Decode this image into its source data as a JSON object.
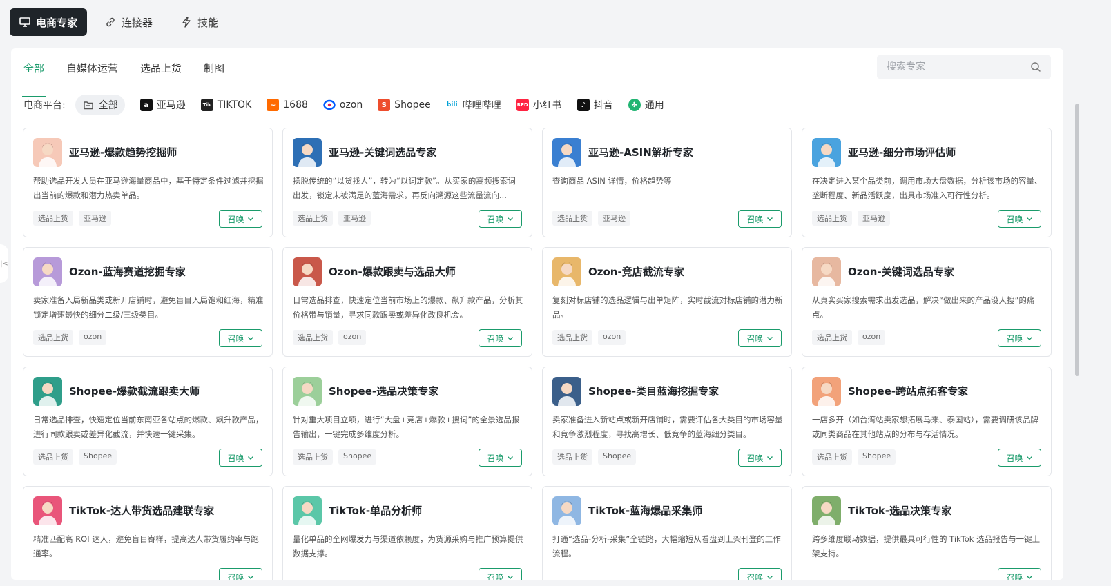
{
  "top_tabs": [
    {
      "label": "电商专家",
      "icon": "monitor-icon",
      "active": true
    },
    {
      "label": "连接器",
      "icon": "link-icon",
      "active": false
    },
    {
      "label": "技能",
      "icon": "lightning-icon",
      "active": false
    }
  ],
  "sub_tabs": [
    {
      "label": "全部",
      "active": true
    },
    {
      "label": "自媒体运营",
      "active": false
    },
    {
      "label": "选品上货",
      "active": false
    },
    {
      "label": "制图",
      "active": false
    }
  ],
  "search": {
    "placeholder": "搜索专家"
  },
  "platforms": {
    "label": "电商平台:",
    "items": [
      {
        "label": "全部",
        "icon": "folder-icon",
        "color": "#555555",
        "active": true
      },
      {
        "label": "亚马逊",
        "icon": "amazon-icon",
        "color": "#111111"
      },
      {
        "label": "TIKTOK",
        "icon": "tiktok-icon",
        "color": "#222222"
      },
      {
        "label": "1688",
        "icon": "1688-icon",
        "color": "#ff6a00"
      },
      {
        "label": "ozon",
        "icon": "ozon-icon",
        "color": "#005bff"
      },
      {
        "label": "Shopee",
        "icon": "shopee-icon",
        "color": "#ee4d2d"
      },
      {
        "label": "哔哩哔哩",
        "icon": "bilibili-icon",
        "color": "#00a1d6"
      },
      {
        "label": "小红书",
        "icon": "xiaohongshu-icon",
        "color": "#ff2442"
      },
      {
        "label": "抖音",
        "icon": "douyin-icon",
        "color": "#111111"
      },
      {
        "label": "通用",
        "icon": "general-icon",
        "color": "#22b573"
      }
    ]
  },
  "summon_label": "召唤",
  "cards": [
    {
      "title": "亚马逊-爆款趋势挖掘师",
      "desc": "帮助选品开发人员在亚马逊海量商品中，基于特定条件过滤并挖掘出当前的爆款和潜力热卖单品。",
      "tags": [
        "选品上货",
        "亚马逊"
      ],
      "avatar_color": "#f6c9b8"
    },
    {
      "title": "亚马逊-关键词选品专家",
      "desc": "摆脱传统的“以货找人”，转为“以词定款”。从买家的高频搜索词出发，锁定未被满足的蓝海需求，再反向溯源这些流量流向...",
      "tags": [
        "选品上货",
        "亚马逊"
      ],
      "avatar_color": "#2d6fb5"
    },
    {
      "title": "亚马逊-ASIN解析专家",
      "desc": "查询商品 ASIN 详情，价格趋势等",
      "tags": [
        "选品上货",
        "亚马逊"
      ],
      "avatar_color": "#3a7fd1"
    },
    {
      "title": "亚马逊-细分市场评估师",
      "desc": "在决定进入某个品类前，调用市场大盘数据，分析该市场的容量、垄断程度、新品活跃度，出具市场准入可行性分析。",
      "tags": [
        "选品上货",
        "亚马逊"
      ],
      "avatar_color": "#4aa3df"
    },
    {
      "title": "Ozon-蓝海赛道挖掘专家",
      "desc": "卖家准备入局新品类或新开店铺时，避免盲目入局饱和红海，精准锁定增速最快的细分二级/三级类目。",
      "tags": [
        "选品上货",
        "ozon"
      ],
      "avatar_color": "#b79ad9"
    },
    {
      "title": "Ozon-爆款跟卖与选品大师",
      "desc": "日常选品排查，快速定位当前市场上的爆款、飙升款产品，分析其价格带与销量，寻求同款跟卖或差异化改良机会。",
      "tags": [
        "选品上货",
        "ozon"
      ],
      "avatar_color": "#c9584a"
    },
    {
      "title": "Ozon-竞店截流专家",
      "desc": "复刻对标店铺的选品逻辑与出单矩阵，实时截流对标店铺的潜力新品。",
      "tags": [
        "选品上货",
        "ozon"
      ],
      "avatar_color": "#e8b76a"
    },
    {
      "title": "Ozon-关键词选品专家",
      "desc": "从真实买家搜索需求出发选品，解决“做出来的产品没人搜”的痛点。",
      "tags": [
        "选品上货",
        "ozon"
      ],
      "avatar_color": "#e7b8a0"
    },
    {
      "title": "Shopee-爆款截流跟卖大师",
      "desc": "日常选品排查，快速定位当前东南亚各站点的爆款、飙升款产品，进行同款跟卖或差异化截流，并快速一键采集。",
      "tags": [
        "选品上货",
        "Shopee"
      ],
      "avatar_color": "#2f9e8a"
    },
    {
      "title": "Shopee-选品决策专家",
      "desc": "针对重大项目立项，进行“大盘+竞店+爆款+搜词”的全景选品报告输出，一键完成多维度分析。",
      "tags": [
        "选品上货",
        "Shopee"
      ],
      "avatar_color": "#9ccf9a"
    },
    {
      "title": "Shopee-类目蓝海挖掘专家",
      "desc": "卖家准备进入新站点或新开店铺时，需要评估各大类目的市场容量和竞争激烈程度，寻找高增长、低竞争的蓝海细分类目。",
      "tags": [
        "选品上货",
        "Shopee"
      ],
      "avatar_color": "#3b5f8a"
    },
    {
      "title": "Shopee-跨站点拓客专家",
      "desc": "一店多开（如台湾站卖家想拓展马来、泰国站），需要调研该品牌或同类商品在其他站点的分布与存活情况。",
      "tags": [
        "选品上货",
        "Shopee"
      ],
      "avatar_color": "#f2a27a"
    },
    {
      "title": "TikTok-达人带货选品建联专家",
      "desc": "精准匹配高 ROI 达人，避免盲目寄样，提高达人带货履约率与跑通率。",
      "tags": [],
      "avatar_color": "#e9557a"
    },
    {
      "title": "TikTok-单品分析师",
      "desc": "量化单品的全网爆发力与渠道依赖度，为货源采购与推广预算提供数据支撑。",
      "tags": [],
      "avatar_color": "#5bc7a8"
    },
    {
      "title": "TikTok-蓝海爆品采集师",
      "desc": "打通“选品-分析-采集”全链路，大幅缩短从看盘到上架刊登的工作流程。",
      "tags": [],
      "avatar_color": "#8fb7e3"
    },
    {
      "title": "TikTok-选品决策专家",
      "desc": "跨多维度联动数据，提供最具可行性的 TikTok 选品报告与一键上架支持。",
      "tags": [],
      "avatar_color": "#7fae6b"
    }
  ]
}
